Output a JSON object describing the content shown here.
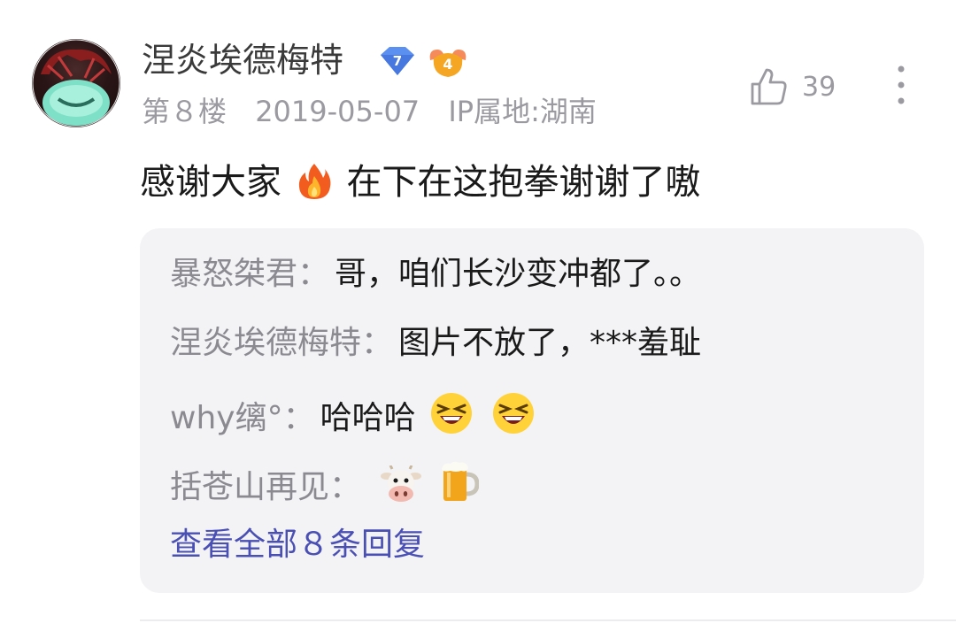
{
  "post": {
    "username": "涅炎埃德梅特",
    "level_badge": "7",
    "fan_badge": "4",
    "floor": "第８楼",
    "date": "2019-05-07",
    "ip_location": "IP属地:湖南",
    "like_count": "39",
    "content_before": "感谢大家",
    "content_emoji": "fire-emoji",
    "content_after": "在下在这抱拳谢谢了嗷"
  },
  "replies": [
    {
      "name": "暴怒桀君",
      "separator": "：",
      "text": "哥，咱们长沙变冲都了。。"
    },
    {
      "name": "涅炎埃德梅特",
      "separator": "：",
      "text": "图片不放了，***羞耻"
    },
    {
      "name": "why缡°",
      "separator": "：",
      "text": "哈哈哈",
      "emojis": [
        "laughing-emoji",
        "laughing-emoji"
      ]
    },
    {
      "name": "括苍山再见",
      "separator": "：",
      "text": "",
      "emojis": [
        "cow-emoji",
        "beer-mug-emoji"
      ]
    }
  ],
  "view_all": "查看全部８条回复",
  "colors": {
    "link": "#4a4fb3",
    "meta": "#9a9aa0",
    "reply_bg": "#f3f3f6",
    "level_badge": "#5b8ff0",
    "fan_badge": "#f5a623"
  }
}
